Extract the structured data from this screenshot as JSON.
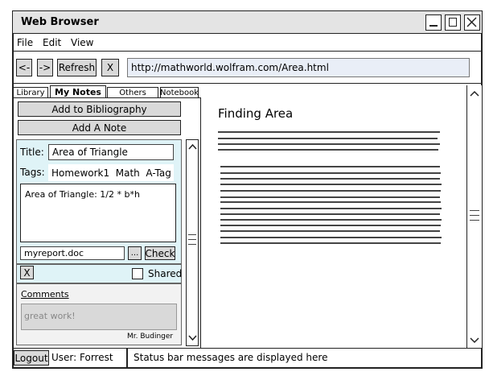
{
  "window": {
    "title": "Web Browser"
  },
  "menu": [
    "File",
    "Edit",
    "View"
  ],
  "toolbar": {
    "back": "<-",
    "forward": "->",
    "refresh": "Refresh",
    "stop": "X",
    "url": "http://mathworld.wolfram.com/Area.html"
  },
  "tabs": [
    "Library",
    "My Notes",
    "Others",
    "Notebook"
  ],
  "sidebar": {
    "add_bibliography": "Add to Bibliography",
    "add_note": "Add A Note",
    "title_label": "Title:",
    "title_value": "Area of Triangle",
    "tags_label": "Tags:",
    "tags_value": "Homework1  Math  A-Tag",
    "note_body": "Area of Triangle: 1/2 * b*h",
    "file_value": "myreport.doc",
    "browse": "...",
    "check": "Check",
    "delete": "X",
    "shared_label": "Shared",
    "comments_label": "Comments",
    "comment_text": "great work!",
    "comment_author": "Mr. Budinger"
  },
  "content": {
    "heading": "Finding Area"
  },
  "statusbar": {
    "logout": "Logout",
    "user": "User: Forrest",
    "message": "Status bar messages are displayed here"
  }
}
